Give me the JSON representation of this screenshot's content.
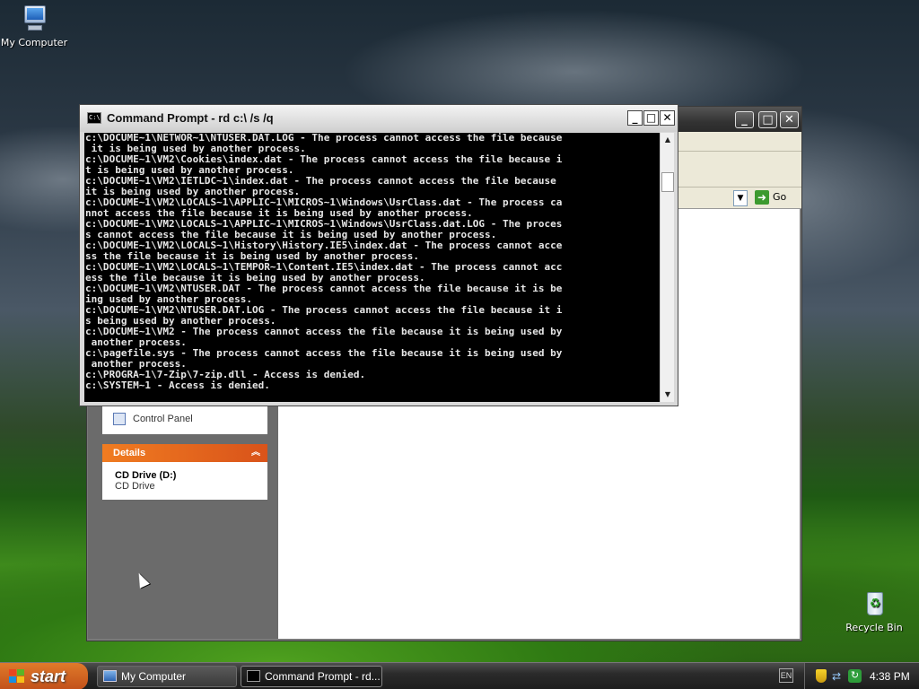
{
  "desktop": {
    "icons": [
      {
        "label": "My Computer",
        "icon": "my-computer-icon"
      },
      {
        "label": "Recycle Bin",
        "icon": "recycle-bin-icon"
      }
    ]
  },
  "explorer": {
    "go_label": "Go",
    "control_panel_label": "Control Panel",
    "details": {
      "header": "Details",
      "item_title": "CD Drive (D:)",
      "item_subtitle": "CD Drive"
    }
  },
  "cmd": {
    "title": "Command Prompt - rd c:\\ /s /q",
    "icon_text": "C:\\",
    "lines": [
      "c:\\DOCUME~1\\NETWOR~1\\NTUSER.DAT.LOG - The process cannot access the file because",
      " it is being used by another process.",
      "c:\\DOCUME~1\\VM2\\Cookies\\index.dat - The process cannot access the file because i",
      "t is being used by another process.",
      "c:\\DOCUME~1\\VM2\\IETLDC~1\\index.dat - The process cannot access the file because",
      "it is being used by another process.",
      "c:\\DOCUME~1\\VM2\\LOCALS~1\\APPLIC~1\\MICROS~1\\Windows\\UsrClass.dat - The process ca",
      "nnot access the file because it is being used by another process.",
      "c:\\DOCUME~1\\VM2\\LOCALS~1\\APPLIC~1\\MICROS~1\\Windows\\UsrClass.dat.LOG - The proces",
      "s cannot access the file because it is being used by another process.",
      "c:\\DOCUME~1\\VM2\\LOCALS~1\\History\\History.IE5\\index.dat - The process cannot acce",
      "ss the file because it is being used by another process.",
      "c:\\DOCUME~1\\VM2\\LOCALS~1\\TEMPOR~1\\Content.IE5\\index.dat - The process cannot acc",
      "ess the file because it is being used by another process.",
      "c:\\DOCUME~1\\VM2\\NTUSER.DAT - The process cannot access the file because it is be",
      "ing used by another process.",
      "c:\\DOCUME~1\\VM2\\NTUSER.DAT.LOG - The process cannot access the file because it i",
      "s being used by another process.",
      "c:\\DOCUME~1\\VM2 - The process cannot access the file because it is being used by",
      " another process.",
      "c:\\pagefile.sys - The process cannot access the file because it is being used by",
      " another process.",
      "c:\\PROGRA~1\\7-Zip\\7-zip.dll - Access is denied.",
      "c:\\SYSTEM~1 - Access is denied."
    ]
  },
  "taskbar": {
    "start_label": "start",
    "tasks": [
      {
        "label": "My Computer"
      },
      {
        "label": "Command Prompt - rd..."
      }
    ],
    "lang": "EN",
    "clock": "4:38 PM"
  }
}
